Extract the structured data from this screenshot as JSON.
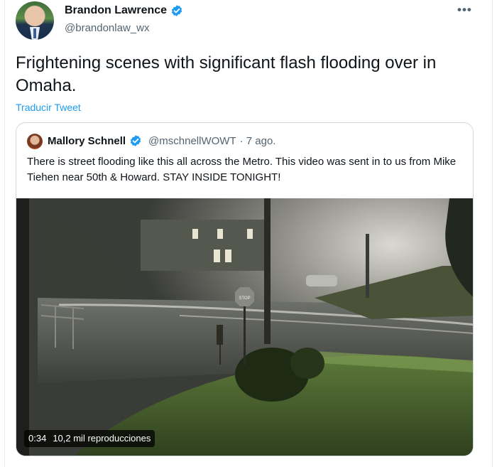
{
  "author": {
    "name": "Brandon Lawrence",
    "handle": "@brandonlaw_wx",
    "verified": true,
    "avatar_icon": "profile-photo"
  },
  "more_icon": "more-horizontal-icon",
  "more_glyph": "•••",
  "tweet": {
    "text": "Frightening scenes with significant flash flooding over in Omaha.",
    "translate_label": "Traducir Tweet"
  },
  "quoted": {
    "name": "Mallory Schnell",
    "handle": "@mschnellWOWT",
    "time": "· 7 ago.",
    "verified": true,
    "text": "There is street flooding like this all across the Metro. This video was sent in to us from Mike Tiehen near 50th & Howard. STAY INSIDE TONIGHT!",
    "video": {
      "duration": "0:34",
      "views": "10,2 mil reproducciones",
      "stop_sign_text": "STOP"
    }
  },
  "colors": {
    "accent": "#1d9bf0",
    "secondary_text": "#536471",
    "border": "#cfd9de"
  }
}
